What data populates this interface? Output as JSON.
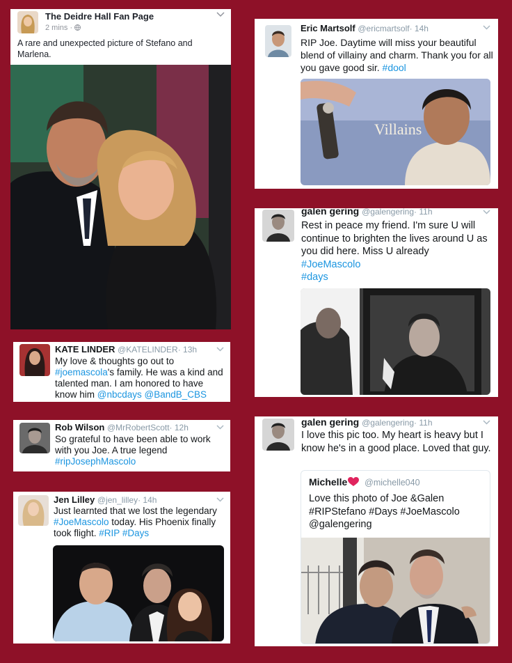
{
  "fb": {
    "page_name": "The Deidre Hall Fan Page",
    "time": "2 mins",
    "separator": " · ",
    "caption": "A rare and unexpected picture of Stefano and Marlena.",
    "icons": [
      "globe-icon",
      "chevron-down-icon"
    ]
  },
  "eric": {
    "name": "Eric Martsolf",
    "handle": "@ericmartsolf",
    "time": "· 14h",
    "text_before": "RIP Joe.  Daytime will miss your beautiful blend of villainy and charm.  Thank you for all you gave good sir. ",
    "tag": "#dool",
    "image_label": "Villains"
  },
  "galen1": {
    "name": "galen gering",
    "handle": "@galengering",
    "time": "· 11h",
    "text": "Rest in peace my friend.  I'm sure U will continue to brighten the lives around U as you did here. Miss U already",
    "tag1": "#JoeMascolo",
    "tag2": "#days"
  },
  "kate": {
    "name": "KATE LINDER",
    "handle": "@KATELINDER",
    "time": "· 13h",
    "line1": "My love & thoughts go out to",
    "tag1": "#joemascola",
    "line2": "'s family. He was a kind and talented man. I am honored to have know him ",
    "tag2": "@nbcdays",
    "tag3": "@BandB_CBS"
  },
  "rob": {
    "name": "Rob Wilson",
    "handle": "@MrRobertScott",
    "time": "· 12h",
    "text": "So grateful to have been able to work with you Joe. A true legend",
    "tag": "#ripJosephMascolo"
  },
  "jen": {
    "name": "Jen Lilley",
    "handle": "@jen_lilley",
    "time": "· 14h",
    "text_before": "Just learnted that we lost the legendary ",
    "tag1": "#JoeMascolo",
    "text_mid": " today. His Phoenix finally took flight. ",
    "tag2": "#RIP",
    "tag3": "#Days"
  },
  "galen2": {
    "name": "galen gering",
    "handle": "@galengering",
    "time": "· 11h",
    "text": "I love this pic too. My heart is heavy but I know he's in a good place. Loved that guy.",
    "quote_name": "Michelle",
    "quote_handle": "@michelle040",
    "quote_text": "Love this photo of Joe &Galen #RIPStefano  #Days #JoeMascolo @galengering"
  },
  "colors": {
    "background": "#8e1128",
    "link": "#1b95e0",
    "muted": "#8899a6"
  }
}
